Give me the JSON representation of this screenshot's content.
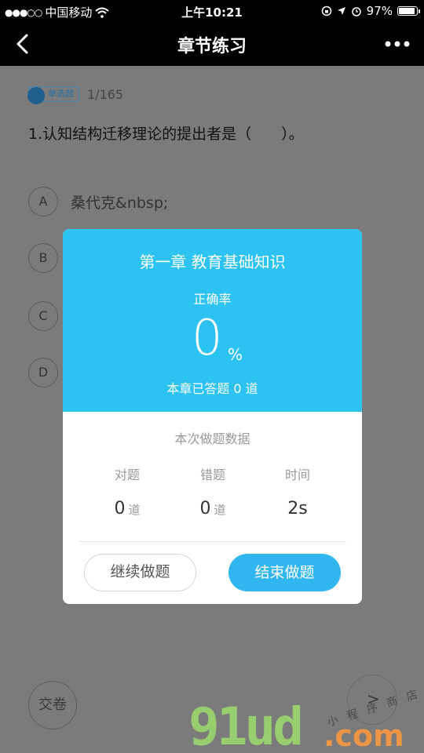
{
  "status_bar": {
    "signal": "●●●○○",
    "carrier": "中国移动",
    "time": "上午10:21",
    "battery_text": "97%",
    "battery_level": 0.97
  },
  "nav": {
    "title": "章节练习"
  },
  "question": {
    "type_tag": "单选题",
    "counter": "1/165",
    "text": "1.认知结构迁移理论的提出者是（　　）。",
    "options": [
      {
        "letter": "A",
        "text": "桑代克&nbsp;"
      },
      {
        "letter": "B",
        "text": ""
      },
      {
        "letter": "C",
        "text": ""
      },
      {
        "letter": "D",
        "text": ""
      }
    ],
    "submit_label": "交卷",
    "next_label": ">"
  },
  "modal": {
    "chapter_title": "第一章 教育基础知识",
    "accuracy_label": "正确率",
    "accuracy_value": "0",
    "accuracy_unit": "%",
    "answered_text": "本章已答题 0 道",
    "session_title": "本次做题数据",
    "stats": [
      {
        "label": "对题",
        "value": "0",
        "unit": "道"
      },
      {
        "label": "错题",
        "value": "0",
        "unit": "道"
      },
      {
        "label": "时间",
        "value": "2s",
        "unit": ""
      }
    ],
    "continue_label": "继续做题",
    "end_label": "结束做题"
  },
  "watermark": {
    "brand": "91ud",
    "tld": ".com",
    "slogan": "小 程 序 商 店"
  }
}
